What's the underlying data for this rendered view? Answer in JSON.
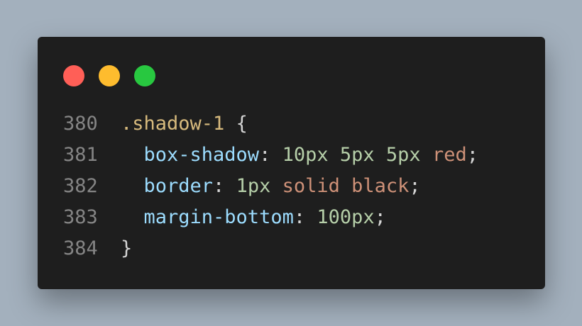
{
  "window_controls": [
    {
      "name": "close",
      "color": "#ff5f57"
    },
    {
      "name": "minimize",
      "color": "#febc2e"
    },
    {
      "name": "maximize",
      "color": "#28c840"
    }
  ],
  "code": {
    "lines": [
      {
        "number": "380",
        "tokens": [
          {
            "text": ".shadow-1",
            "type": "selector"
          },
          {
            "text": " {",
            "type": "default"
          }
        ]
      },
      {
        "number": "381",
        "tokens": [
          {
            "text": "  box-shadow",
            "type": "prop"
          },
          {
            "text": ": ",
            "type": "default"
          },
          {
            "text": "10px 5px 5px",
            "type": "num"
          },
          {
            "text": " ",
            "type": "default"
          },
          {
            "text": "red",
            "type": "kw"
          },
          {
            "text": ";",
            "type": "default"
          }
        ]
      },
      {
        "number": "382",
        "tokens": [
          {
            "text": "  border",
            "type": "prop"
          },
          {
            "text": ": ",
            "type": "default"
          },
          {
            "text": "1px",
            "type": "num"
          },
          {
            "text": " ",
            "type": "default"
          },
          {
            "text": "solid black",
            "type": "kw"
          },
          {
            "text": ";",
            "type": "default"
          }
        ]
      },
      {
        "number": "383",
        "tokens": [
          {
            "text": "  margin-bottom",
            "type": "prop"
          },
          {
            "text": ": ",
            "type": "default"
          },
          {
            "text": "100px",
            "type": "num"
          },
          {
            "text": ";",
            "type": "default"
          }
        ]
      },
      {
        "number": "384",
        "tokens": [
          {
            "text": "}",
            "type": "default"
          }
        ]
      }
    ]
  }
}
